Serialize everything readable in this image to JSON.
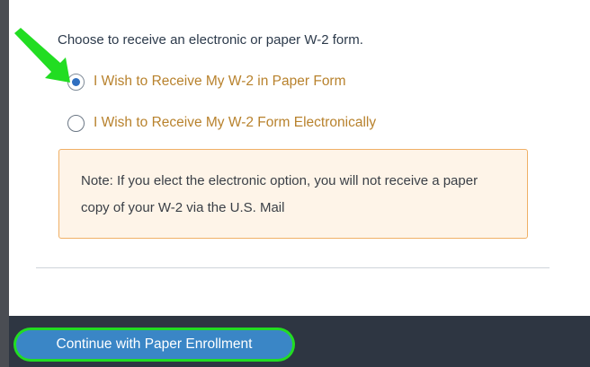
{
  "w2_options": {
    "prompt": "Choose to receive an electronic or paper W-2 form.",
    "options": [
      {
        "label": "I Wish to Receive My W-2 in Paper Form",
        "selected": true
      },
      {
        "label": "I Wish to Receive My W-2 Form Electronically",
        "selected": false
      }
    ],
    "note": "Note: If you elect the electronic option, you will not receive a paper copy of your W-2 via the U.S. Mail"
  },
  "footer": {
    "continue_label": "Continue with Paper Enrollment"
  },
  "colors": {
    "option_text": "#b8822d",
    "radio_selected": "#2f6fc0",
    "note_border": "#f0b066",
    "button_bg": "#3a86c6",
    "highlight": "#22dd22"
  }
}
